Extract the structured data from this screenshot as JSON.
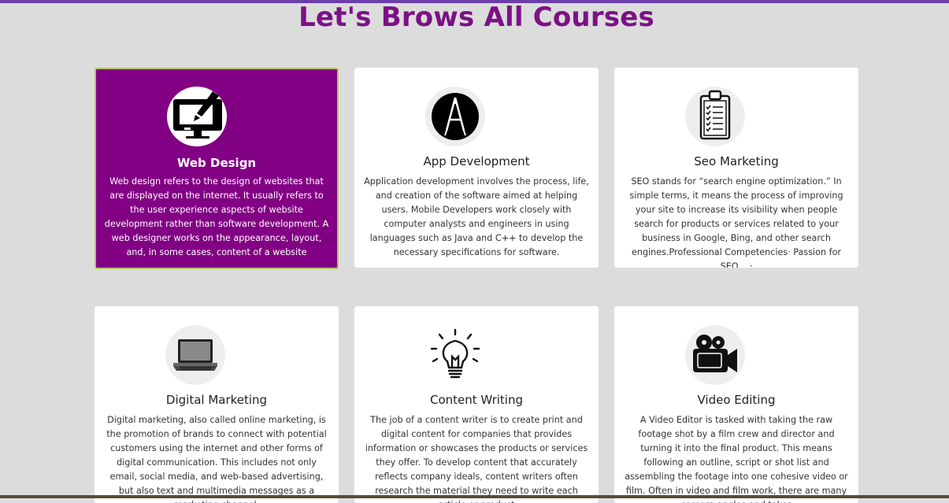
{
  "page": {
    "title": "Let's Brows All Courses"
  },
  "colors": {
    "accent": "#820084",
    "title": "#7b1185",
    "background": "#dcdcdc",
    "topbar": "#6c3fa8"
  },
  "courses": [
    {
      "title": "Web Design",
      "icon": "monitor-brush-icon",
      "active": true,
      "text": "Web design refers to the design of websites that are displayed on the internet. It usually refers to the user experience aspects of website development rather than software development. A web designer works on the appearance, layout, and, in some cases, content of a website"
    },
    {
      "title": "App Development",
      "icon": "app-store-icon",
      "active": false,
      "text": "Application development involves the process, life, and creation of the software aimed at helping users. Mobile Developers work closely with computer analysts and engineers in using languages such as Java and C++ to develop the necessary specifications for software."
    },
    {
      "title": "Seo Marketing",
      "icon": "clipboard-checklist-icon",
      "active": false,
      "text": "SEO stands for “search engine optimization.” In simple terms, it means the process of improving your site to increase its visibility when people search for products or services related to your business in Google, Bing, and other search engines.Professional Competencies· Passion for SEO ...·"
    },
    {
      "title": "Digital Marketing",
      "icon": "laptop-icon",
      "active": false,
      "text": "Digital marketing, also called online marketing, is the promotion of brands to connect with potential customers using the internet and other forms of digital communication. This includes not only email, social media, and web-based advertising, but also text and multimedia messages as a marketing channel."
    },
    {
      "title": "Content Writing",
      "icon": "lightbulb-icon",
      "active": false,
      "text": "The job of a content writer is to create print and digital content for companies that provides information or showcases the products or services they offer. To develop content that accurately reflects company ideals, content writers often research the material they need to write each article or product"
    },
    {
      "title": "Video Editing",
      "icon": "video-camera-icon",
      "active": false,
      "text": "A Video Editor is tasked with taking the raw footage shot by a film crew and director and turning it into the final product. This means following an outline, script or shot list and assembling the footage into one cohesive video or film. Often in video and film work, there are many camera angles and takes"
    }
  ]
}
